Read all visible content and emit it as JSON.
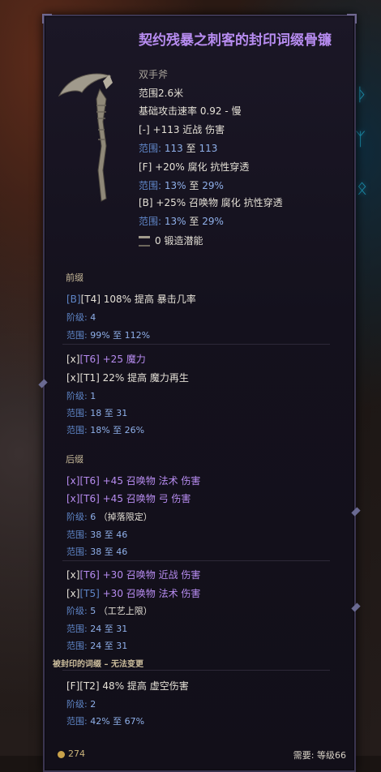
{
  "item": {
    "name": "契约残暴之刺客的封印词缀骨镰",
    "type": "双手斧",
    "range": "范围2.6米",
    "attack_speed": "基础攻击速率 0.92 - 慢",
    "implicits": [
      {
        "text": "[-] +113 近战 伤害",
        "range_label": "范围:",
        "range_min": "113",
        "range_sep": "至",
        "range_max": "113"
      },
      {
        "text": "[F] +20% 腐化 抗性穿透",
        "range_label": "范围:",
        "range_min": "13%",
        "range_sep": "至",
        "range_max": "29%"
      },
      {
        "text": "[B] +25% 召唤物 腐化 抗性穿透",
        "range_label": "范围:",
        "range_min": "13%",
        "range_sep": "至",
        "range_max": "29%"
      }
    ],
    "forge_potential": "0 锻造潜能"
  },
  "prefix": {
    "header": "前缀",
    "affix1": {
      "tag": "[B]",
      "tier": "[T4]",
      "text": "108% 提高 暴击几率",
      "level_label": "阶级:",
      "level": "4",
      "range_label": "范围:",
      "range": "99% 至 112%"
    },
    "affix2": {
      "lines": [
        {
          "tag": "[x]",
          "tier": "[T6]",
          "text": "+25 魔力"
        },
        {
          "tag": "[x]",
          "tier": "[T1]",
          "text": "22% 提高 魔力再生"
        }
      ],
      "level_label": "阶级:",
      "level": "1",
      "range1_label": "范围:",
      "range1": "18 至 31",
      "range2_label": "范围:",
      "range2": "18% 至 26%"
    }
  },
  "suffix": {
    "header": "后缀",
    "affix1": {
      "lines": [
        {
          "tag": "[x]",
          "tier": "[T6]",
          "text": "+45 召唤物 法术 伤害"
        },
        {
          "tag": "[x]",
          "tier": "[T6]",
          "text": "+45 召唤物 弓 伤害"
        }
      ],
      "level_label": "阶级:",
      "level": "6",
      "note": "（掉落限定）",
      "range1_label": "范围:",
      "range1": "38 至 46",
      "range2_label": "范围:",
      "range2": "38 至 46"
    },
    "affix2": {
      "lines": [
        {
          "tag": "[x]",
          "tier": "[T6]",
          "text": "+30 召唤物 近战 伤害"
        },
        {
          "tag": "[x]",
          "tier": "[T5]",
          "text": "+30 召唤物 法术 伤害"
        }
      ],
      "level_label": "阶级:",
      "level": "5",
      "note": "（工艺上限）",
      "range1_label": "范围:",
      "range1": "24 至 31",
      "range2_label": "范围:",
      "range2": "24 至 31"
    }
  },
  "sealed": {
    "header": "被封印的词缀 – 无法变更",
    "affix": {
      "tag": "[F]",
      "tier": "[T2]",
      "text": "48% 提高 虚空伤害",
      "level_label": "阶级:",
      "level": "2",
      "range_label": "范围:",
      "range": "42% 至 67%"
    }
  },
  "footer": {
    "price": "274",
    "requirement": "需要: 等级66"
  },
  "colors": {
    "title": "#b78cf0",
    "range": "#5f86c8",
    "text": "#e4e0d6",
    "panel": "#14111d"
  },
  "icons": [
    "scythe-icon",
    "forge-icon",
    "coin-icon"
  ]
}
